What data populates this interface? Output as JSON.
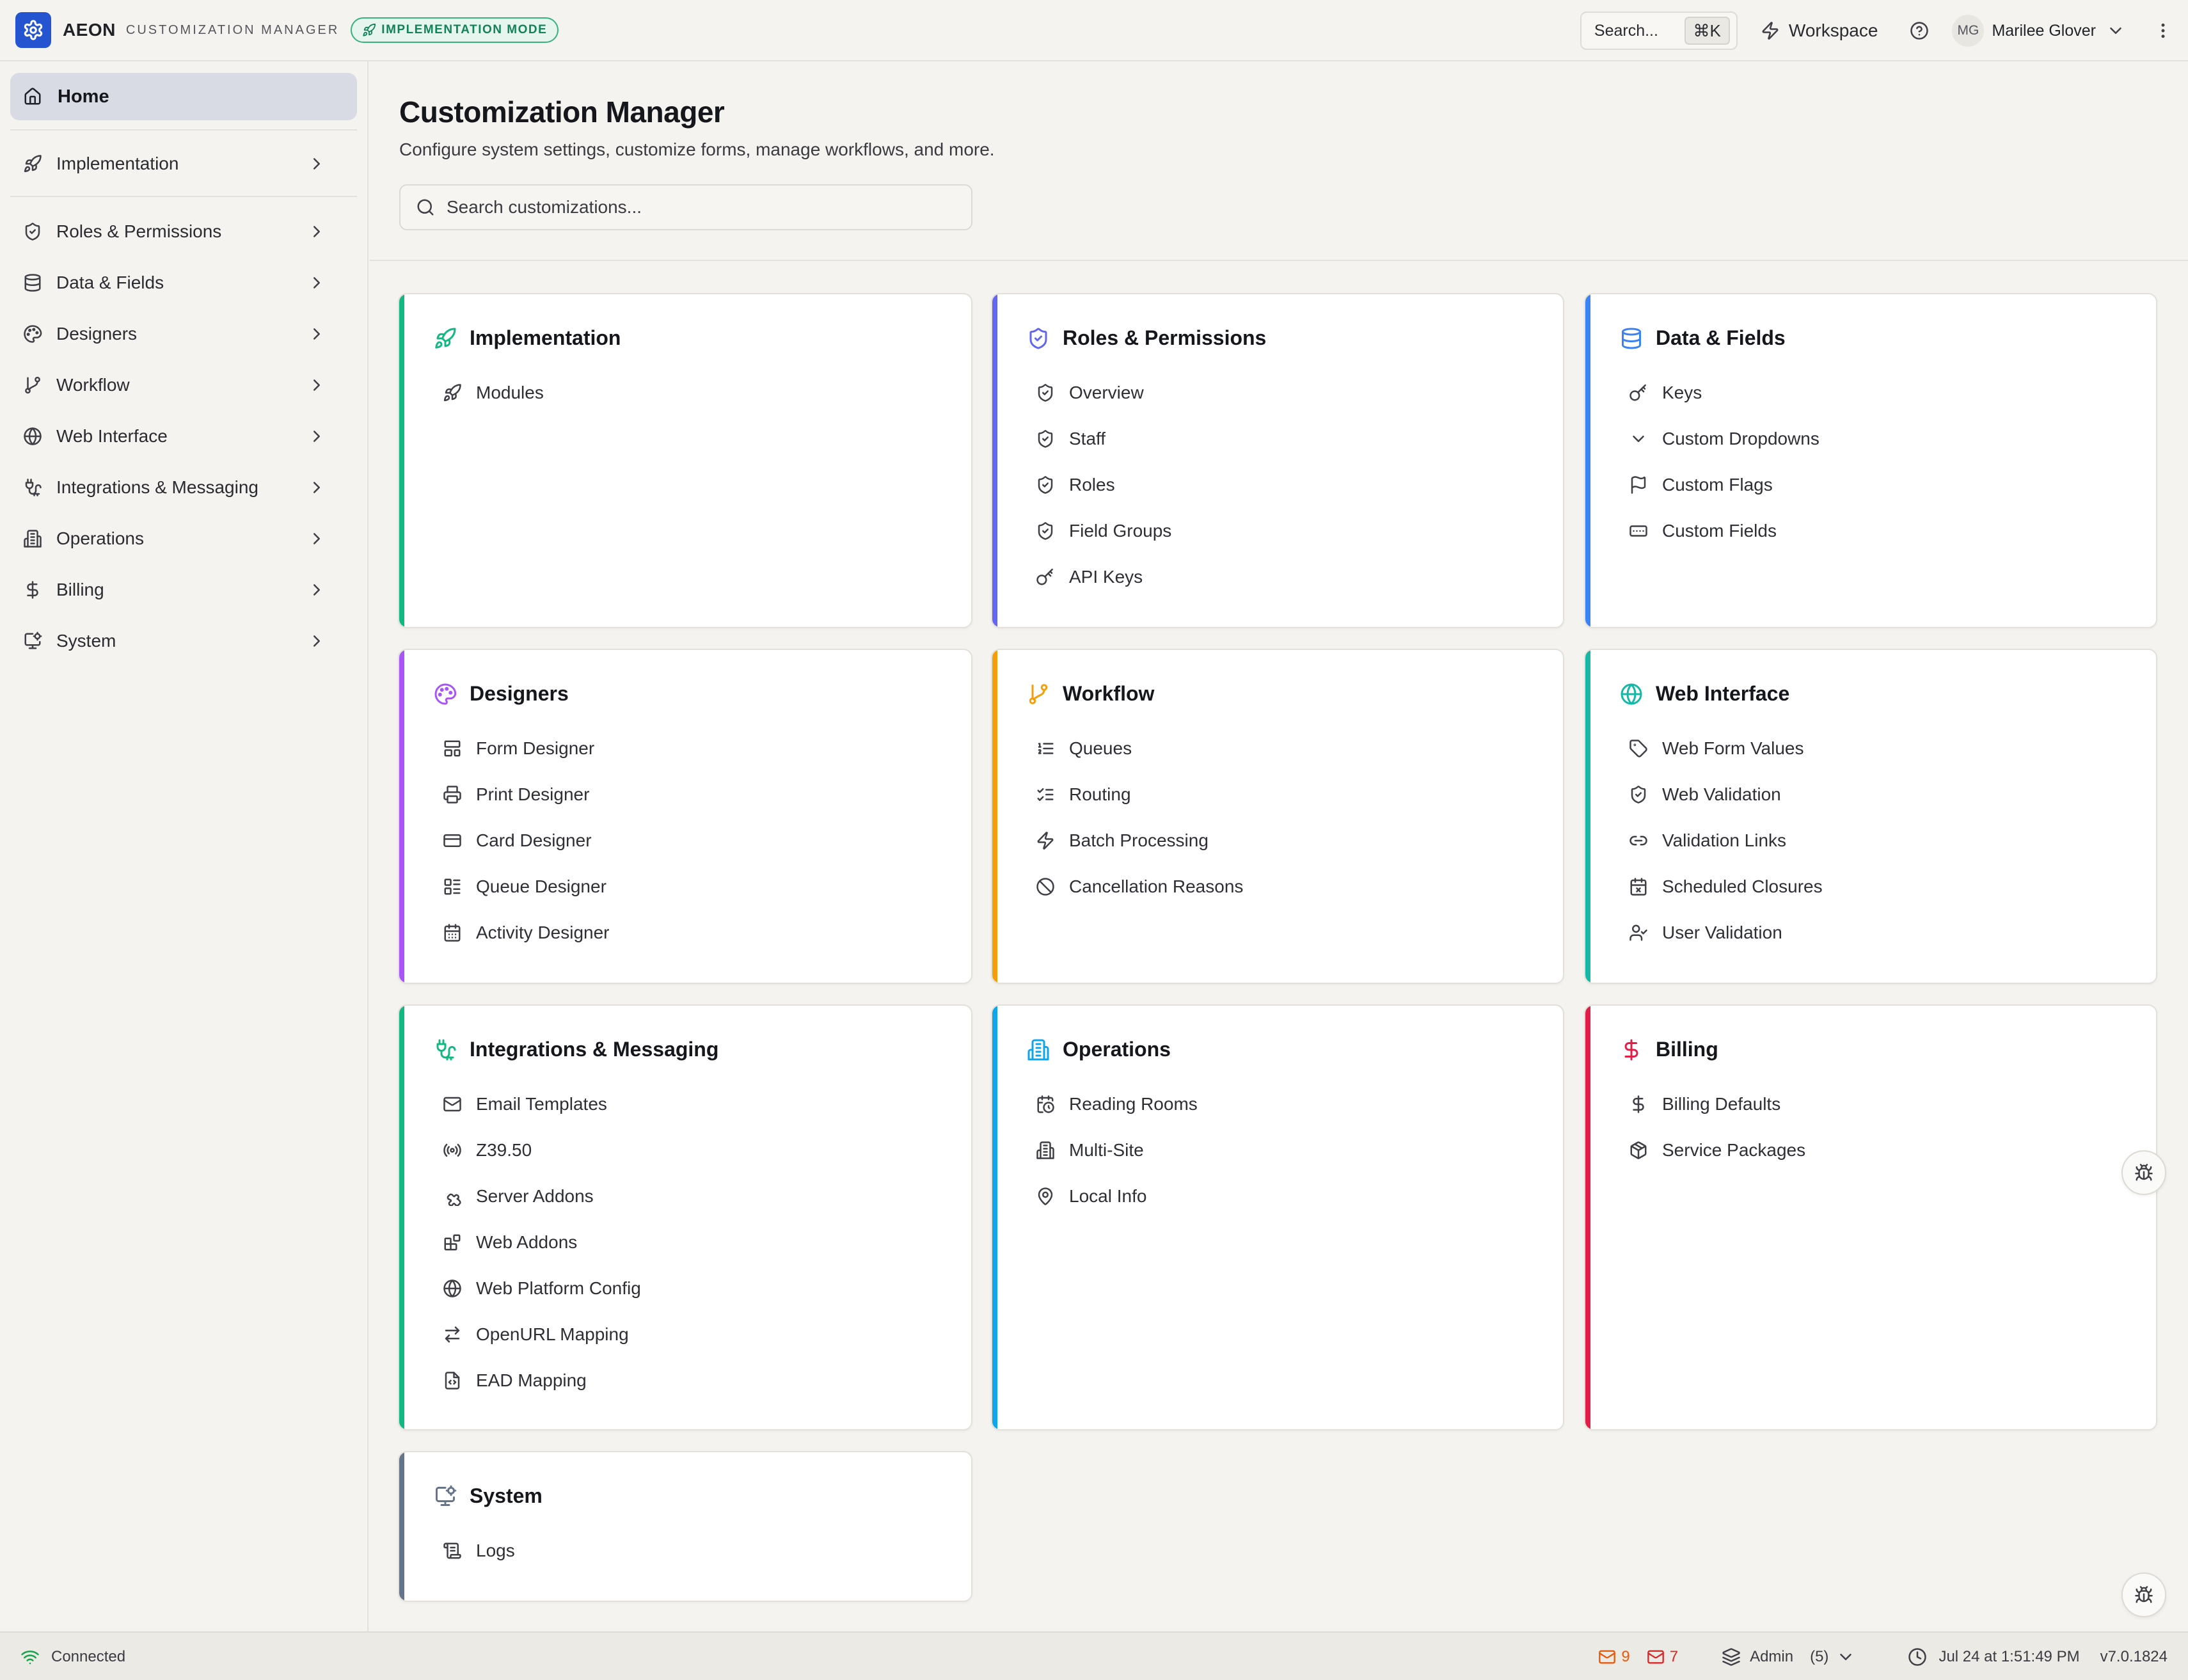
{
  "topbar": {
    "brand": "AEON",
    "subbrand": "CUSTOMIZATION MANAGER",
    "mode_badge": "IMPLEMENTATION MODE",
    "search_label": "Search...",
    "search_shortcut": "⌘K",
    "workspace_label": "Workspace",
    "user_initials": "MG",
    "user_name": "Marilee Glover"
  },
  "sidebar": {
    "home_label": "Home",
    "items": [
      {
        "label": "Implementation",
        "icon": "rocket-icon"
      },
      {
        "label": "Roles & Permissions",
        "icon": "shield-icon"
      },
      {
        "label": "Data & Fields",
        "icon": "database-icon"
      },
      {
        "label": "Designers",
        "icon": "palette-icon"
      },
      {
        "label": "Workflow",
        "icon": "git-branch-icon"
      },
      {
        "label": "Web Interface",
        "icon": "globe-icon"
      },
      {
        "label": "Integrations & Messaging",
        "icon": "plug-icon"
      },
      {
        "label": "Operations",
        "icon": "building-icon"
      },
      {
        "label": "Billing",
        "icon": "dollar-icon"
      },
      {
        "label": "System",
        "icon": "monitor-cog-icon"
      }
    ]
  },
  "main": {
    "title": "Customization Manager",
    "subtitle": "Configure system settings, customize forms, manage workflows, and more.",
    "search_placeholder": "Search customizations..."
  },
  "cards": [
    {
      "title": "Implementation",
      "accent": "#10b981",
      "icon": "rocket-icon",
      "items": [
        {
          "label": "Modules",
          "icon": "rocket-icon"
        }
      ]
    },
    {
      "title": "Roles & Permissions",
      "accent": "#6366f1",
      "icon": "shield-icon",
      "items": [
        {
          "label": "Overview",
          "icon": "shield-icon"
        },
        {
          "label": "Staff",
          "icon": "shield-icon"
        },
        {
          "label": "Roles",
          "icon": "shield-icon"
        },
        {
          "label": "Field Groups",
          "icon": "shield-icon"
        },
        {
          "label": "API Keys",
          "icon": "key-icon"
        }
      ]
    },
    {
      "title": "Data & Fields",
      "accent": "#3b82f6",
      "icon": "database-icon",
      "items": [
        {
          "label": "Keys",
          "icon": "key-icon"
        },
        {
          "label": "Custom Dropdowns",
          "icon": "chevron-down-icon"
        },
        {
          "label": "Custom Flags",
          "icon": "flag-icon"
        },
        {
          "label": "Custom Fields",
          "icon": "textbox-icon"
        }
      ]
    },
    {
      "title": "Designers",
      "accent": "#a855f7",
      "icon": "palette-icon",
      "items": [
        {
          "label": "Form Designer",
          "icon": "layout-icon"
        },
        {
          "label": "Print Designer",
          "icon": "printer-icon"
        },
        {
          "label": "Card Designer",
          "icon": "credit-card-icon"
        },
        {
          "label": "Queue Designer",
          "icon": "list-layout-icon"
        },
        {
          "label": "Activity Designer",
          "icon": "calendar-icon"
        }
      ]
    },
    {
      "title": "Workflow",
      "accent": "#f59e0b",
      "icon": "git-branch-icon",
      "items": [
        {
          "label": "Queues",
          "icon": "list-ordered-icon"
        },
        {
          "label": "Routing",
          "icon": "list-checks-icon"
        },
        {
          "label": "Batch Processing",
          "icon": "zap-icon"
        },
        {
          "label": "Cancellation Reasons",
          "icon": "ban-icon"
        }
      ]
    },
    {
      "title": "Web Interface",
      "accent": "#14b8a6",
      "icon": "globe-icon",
      "items": [
        {
          "label": "Web Form Values",
          "icon": "tag-icon"
        },
        {
          "label": "Web Validation",
          "icon": "shield-icon"
        },
        {
          "label": "Validation Links",
          "icon": "link-icon"
        },
        {
          "label": "Scheduled Closures",
          "icon": "calendar-x-icon"
        },
        {
          "label": "User Validation",
          "icon": "user-check-icon"
        }
      ]
    },
    {
      "title": "Integrations & Messaging",
      "accent": "#10b981",
      "icon": "plug-icon",
      "items": [
        {
          "label": "Email Templates",
          "icon": "mail-icon"
        },
        {
          "label": "Z39.50",
          "icon": "radio-tower-icon"
        },
        {
          "label": "Server Addons",
          "icon": "puzzle-icon"
        },
        {
          "label": "Web Addons",
          "icon": "blocks-icon"
        },
        {
          "label": "Web Platform Config",
          "icon": "globe-icon"
        },
        {
          "label": "OpenURL Mapping",
          "icon": "arrows-swap-icon"
        },
        {
          "label": "EAD Mapping",
          "icon": "file-code-icon"
        }
      ]
    },
    {
      "title": "Operations",
      "accent": "#0ea5e9",
      "icon": "building-icon",
      "items": [
        {
          "label": "Reading Rooms",
          "icon": "calendar-clock-icon"
        },
        {
          "label": "Multi-Site",
          "icon": "building-icon"
        },
        {
          "label": "Local Info",
          "icon": "map-pin-icon"
        }
      ]
    },
    {
      "title": "Billing",
      "accent": "#e11d48",
      "icon": "dollar-icon",
      "items": [
        {
          "label": "Billing Defaults",
          "icon": "dollar-icon"
        },
        {
          "label": "Service Packages",
          "icon": "package-icon"
        }
      ]
    },
    {
      "title": "System",
      "accent": "#64748b",
      "icon": "monitor-cog-icon",
      "items": [
        {
          "label": "Logs",
          "icon": "scroll-icon"
        }
      ]
    }
  ],
  "statusbar": {
    "connection": "Connected",
    "mail_orange_count": "9",
    "mail_red_count": "7",
    "role": "Admin",
    "role_count": "(5)",
    "datetime": "Jul 24 at 1:51:49 PM",
    "version": "v7.0.1824"
  },
  "colors": {
    "brand": "#2554d0",
    "mode_badge": "#12825a",
    "connected": "#16a34a"
  }
}
